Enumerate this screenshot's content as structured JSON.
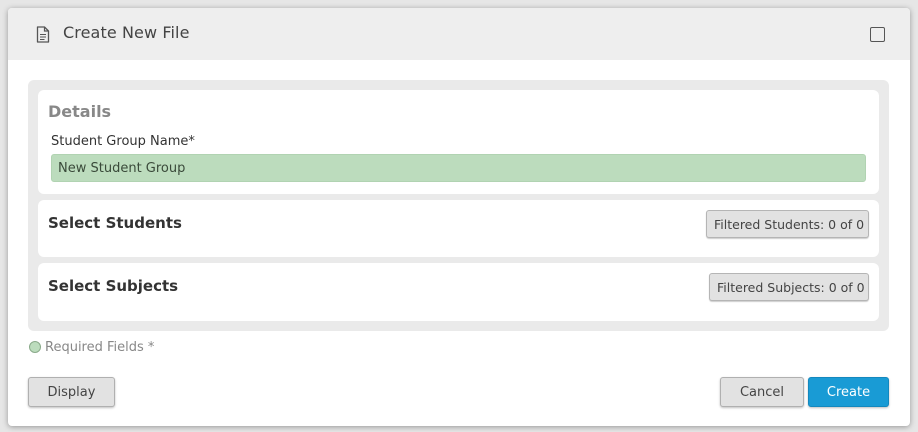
{
  "dialog": {
    "title": "Create New File",
    "title_icon": "document-icon",
    "maximize_icon": "maximize-icon"
  },
  "details": {
    "section_title": "Details",
    "group_name_label": "Student Group Name*",
    "group_name_value": "New Student Group"
  },
  "students": {
    "section_title": "Select Students",
    "filter_label": "Filtered Students: 0 of 0"
  },
  "subjects": {
    "section_title": "Select Subjects",
    "filter_label": "Filtered Subjects: 0 of 0"
  },
  "legend": {
    "required_text": "Required Fields *",
    "required_color": "#bcdcbd"
  },
  "footer": {
    "display_label": "Display",
    "cancel_label": "Cancel",
    "create_label": "Create",
    "create_color": "#199bd5"
  }
}
